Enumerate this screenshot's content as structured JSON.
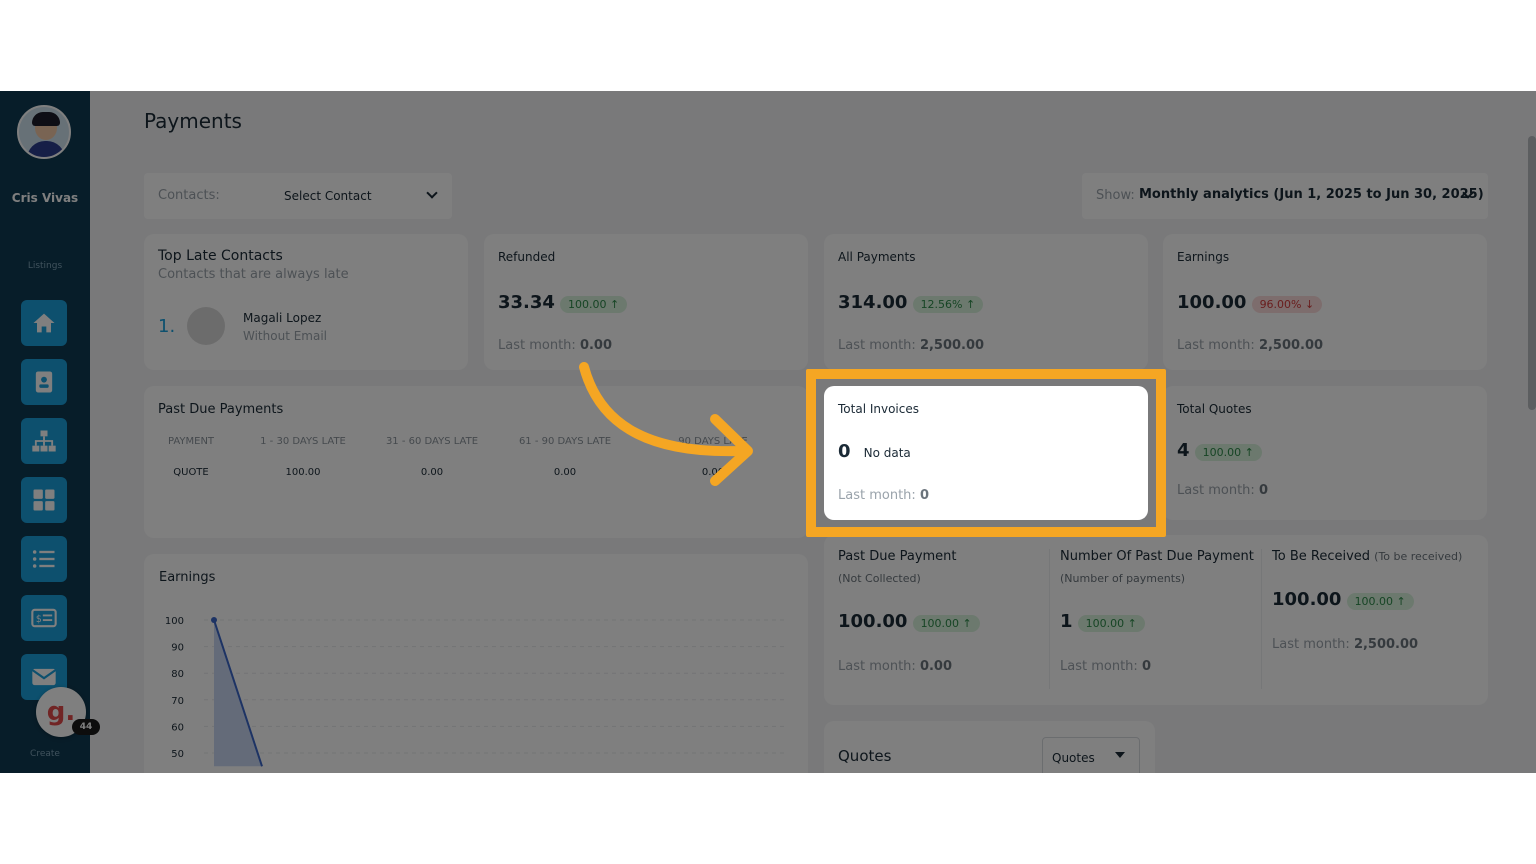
{
  "sidebar": {
    "user_name": "Cris Vivas",
    "section_label": "Listings",
    "create_label": "Create",
    "items": [
      {
        "icon": "home-icon"
      },
      {
        "icon": "contact-card-icon"
      },
      {
        "icon": "hierarchy-icon"
      },
      {
        "icon": "grid-icon"
      },
      {
        "icon": "list-icon"
      },
      {
        "icon": "invoice-icon"
      },
      {
        "icon": "mail-icon"
      }
    ],
    "badge_letter": "g.",
    "badge_count": "44"
  },
  "page": {
    "title": "Payments"
  },
  "filters": {
    "contacts_label": "Contacts:",
    "contacts_value": "Select Contact",
    "show_label": "Show:",
    "show_value": "Monthly analytics (Jun 1, 2025 to Jun 30, 2025)"
  },
  "top_late": {
    "title": "Top Late Contacts",
    "subtitle": "Contacts that are always late",
    "rank": "1.",
    "name": "Magali Lopez",
    "email": "Without Email"
  },
  "refunded": {
    "label": "Refunded",
    "value": "33.34",
    "change": "100.00 ↑",
    "last_label": "Last month:",
    "last_value": "0.00"
  },
  "all_payments": {
    "label": "All Payments",
    "value": "314.00",
    "change": "12.56% ↑",
    "last_label": "Last month:",
    "last_value": "2,500.00"
  },
  "earnings_card": {
    "label": "Earnings",
    "value": "100.00",
    "change": "96.00% ↓",
    "last_label": "Last month:",
    "last_value": "2,500.00"
  },
  "past_due": {
    "title": "Past Due Payments",
    "headers": [
      "PAYMENT",
      "1 - 30 DAYS LATE",
      "31 - 60 DAYS LATE",
      "61 - 90 DAYS LATE",
      "90 DAYS LATE"
    ],
    "row": [
      "QUOTE",
      "100.00",
      "0.00",
      "0.00",
      "0.00"
    ]
  },
  "total_invoices": {
    "label": "Total Invoices",
    "value": "0",
    "note": "No data",
    "last_label": "Last month:",
    "last_value": "0"
  },
  "total_quotes": {
    "label": "Total Quotes",
    "value": "4",
    "change": "100.00 ↑",
    "last_label": "Last month:",
    "last_value": "0"
  },
  "earnings_chart": {
    "title": "Earnings"
  },
  "chart_data": {
    "type": "area",
    "title": "Earnings",
    "yticks": [
      "100",
      "90",
      "80",
      "70",
      "60",
      "50"
    ],
    "ylim": [
      50,
      100
    ],
    "series": [
      {
        "values": [
          100,
          45
        ]
      }
    ]
  },
  "metrics": {
    "past_due_payment": {
      "label": "Past Due Payment",
      "sub": "(Not Collected)",
      "value": "100.00",
      "change": "100.00 ↑",
      "last_label": "Last month:",
      "last_value": "0.00"
    },
    "num_past_due": {
      "label": "Number Of Past Due Payment",
      "sub": "(Number of payments)",
      "value": "1",
      "change": "100.00 ↑",
      "last_label": "Last month:",
      "last_value": "0"
    },
    "to_be_received": {
      "label": "To Be Received",
      "sub": "(To be received)",
      "value": "100.00",
      "change": "100.00 ↑",
      "last_label": "Last month:",
      "last_value": "2,500.00"
    }
  },
  "quotes": {
    "title": "Quotes",
    "select_value": "Quotes"
  },
  "colors": {
    "sidebar": "#0f3a52",
    "nav_button": "#1aa1dd",
    "highlight": "#f5a623"
  }
}
